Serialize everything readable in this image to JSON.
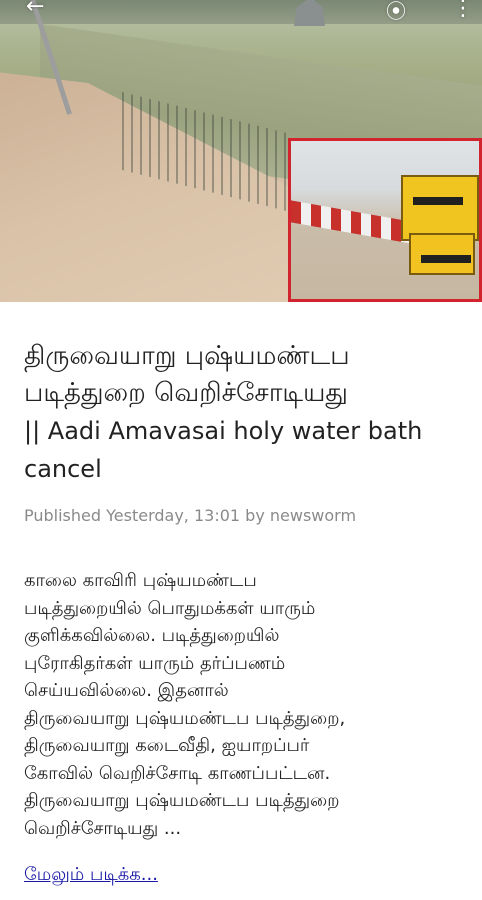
{
  "hero": {
    "top_icons": {
      "back": "arrow-left-icon",
      "share": "share-icon",
      "more": "more-vertical-icon"
    }
  },
  "article": {
    "title_line1": "திருவையாறு புஷ்யமண்டப",
    "title_line2": "படித்துறை வெறிச்சோடியது",
    "title_line3": "|| Aadi Amavasai holy water bath",
    "title_line4": "cancel",
    "meta": "Published Yesterday, 13:01 by newsworm",
    "body": "காலை காவிரி புஷ்யமண்டப\nபடித்துறையில் பொதுமக்கள் யாரும்\nகுளிக்கவில்லை. படித்துறையில்\nபுரோகிதர்கள் யாரும் தர்ப்பணம்\nசெய்யவில்லை. இதனால்\nதிருவையாறு புஷ்யமண்டப படித்துறை,\nதிருவையாறு கடைவீதி, ஐயாறப்பர்\nகோவில் வெறிச்சோடி காணப்பட்டன.\nதிருவையாறு புஷ்யமண்டப படித்துறை\nவெறிச்சோடியது ...",
    "read_more": "மேலும் படிக்க..."
  },
  "colors": {
    "inset_border": "#d1242f",
    "link": "#1a1aa6",
    "text": "#222222",
    "meta": "#8a8a8a"
  }
}
